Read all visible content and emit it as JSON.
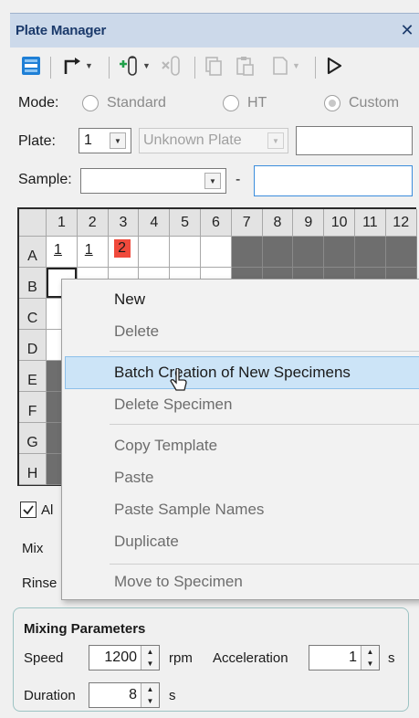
{
  "window": {
    "title": "Plate Manager",
    "close_glyph": "✕"
  },
  "toolbar": {
    "icons": [
      "plate-layout-icon",
      "route-icon",
      "add-sample-icon",
      "remove-sample-icon",
      "copy-icon",
      "paste-icon",
      "document-icon",
      "play-icon"
    ]
  },
  "mode": {
    "label": "Mode:",
    "options": [
      "Standard",
      "HT",
      "Custom"
    ],
    "selected": "Custom"
  },
  "plate": {
    "label": "Plate:",
    "number": "1",
    "type_placeholder": "Unknown Plate",
    "name_value": ""
  },
  "sample": {
    "label": "Sample:",
    "value": "",
    "dash": "-",
    "range_value": ""
  },
  "grid": {
    "columns": [
      "1",
      "2",
      "3",
      "4",
      "5",
      "6",
      "7",
      "8",
      "9",
      "10",
      "11",
      "12"
    ],
    "rows": [
      "A",
      "B",
      "C",
      "D",
      "E",
      "F",
      "G",
      "H"
    ],
    "cells": {
      "A1": "1",
      "A2": "1",
      "A3": "2"
    },
    "highlight_color": "#f04a3c"
  },
  "context_menu": {
    "items": [
      {
        "label": "New",
        "enabled": true
      },
      {
        "label": "Delete",
        "enabled": false
      },
      {
        "label": "Batch Creation of New Specimens",
        "enabled": true,
        "highlighted": true
      },
      {
        "label": "Delete Specimen",
        "enabled": false
      },
      {
        "label": "Copy Template",
        "enabled": false
      },
      {
        "label": "Paste",
        "enabled": false
      },
      {
        "label": "Paste Sample Names",
        "enabled": false
      },
      {
        "label": "Duplicate",
        "enabled": false
      },
      {
        "label": "Move to Specimen",
        "enabled": false
      }
    ]
  },
  "bottom": {
    "checkbox_label_partial": "Al",
    "mix_label": "Mix",
    "rinse_label": "Rinse"
  },
  "mixing": {
    "title": "Mixing Parameters",
    "speed_label": "Speed",
    "speed_value": "1200",
    "speed_unit": "rpm",
    "accel_label": "Acceleration",
    "accel_value": "1",
    "accel_unit": "s",
    "duration_label": "Duration",
    "duration_value": "8",
    "duration_unit": "s"
  },
  "colors": {
    "title_bg": "#ccd9ea",
    "menu_highlight": "#cce4f7",
    "well_flag": "#f04a3c",
    "disabled_well": "#6e6e6e"
  }
}
